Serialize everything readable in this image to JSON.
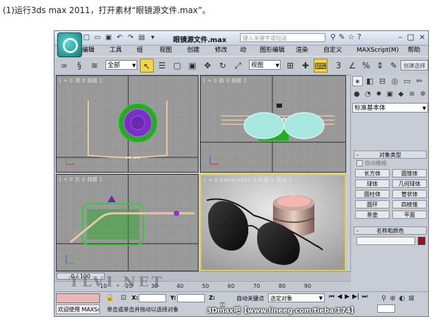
{
  "caption": "(1)运行3ds max 2011，打开素材“眼镜源文件.max”。",
  "window": {
    "title": "眼镜源文件.max",
    "search_placeholder": "键入关键字或短语"
  },
  "menu": [
    "编辑(E)",
    "工具(T)",
    "组(G)",
    "视图(V)",
    "创建(C)",
    "修改器",
    "动画",
    "图形编辑器",
    "渲染(R)",
    "自定义(U)",
    "MAXScript(M)",
    "帮助(H)"
  ],
  "toolbar": {
    "selection_filter": "全部",
    "ref_coord": "视图",
    "create_selection": "创建选择"
  },
  "viewports": {
    "top": "[ + 0 顶 0 线框 ]",
    "front": "[ + 0 前 0 线框 ]",
    "left": "[ + 0 左 0 线框 ]",
    "camera": "[ + 0 Camera001 0 平滑 + 高光 ]"
  },
  "command_panel": {
    "category": "标准基本体",
    "object_type_title": "对象类型",
    "autogrid": "自动栅格",
    "objects": [
      "长方体",
      "圆锥体",
      "球体",
      "几何球体",
      "圆柱体",
      "管状体",
      "圆环",
      "四棱锥",
      "茶壶",
      "平面"
    ],
    "name_color_title": "名称和颜色",
    "object_color": "#9a1020"
  },
  "timeline": {
    "slider": "0 / 100",
    "ticks": [
      "10",
      "20",
      "30",
      "40",
      "50",
      "60",
      "70",
      "80",
      "90"
    ]
  },
  "status": {
    "welcome": "欢迎使用 MAXSc",
    "prompt": "单击或单击并拖动以选择对象",
    "x_label": "X:",
    "y_label": "Y:",
    "z_label": "Z:",
    "auto_key": "自动关键点",
    "selected_object": "选定对象"
  },
  "watermark": "TLVI.NET",
  "footer": "3Dmax吧【www.lineeg.com/tieba/174】"
}
